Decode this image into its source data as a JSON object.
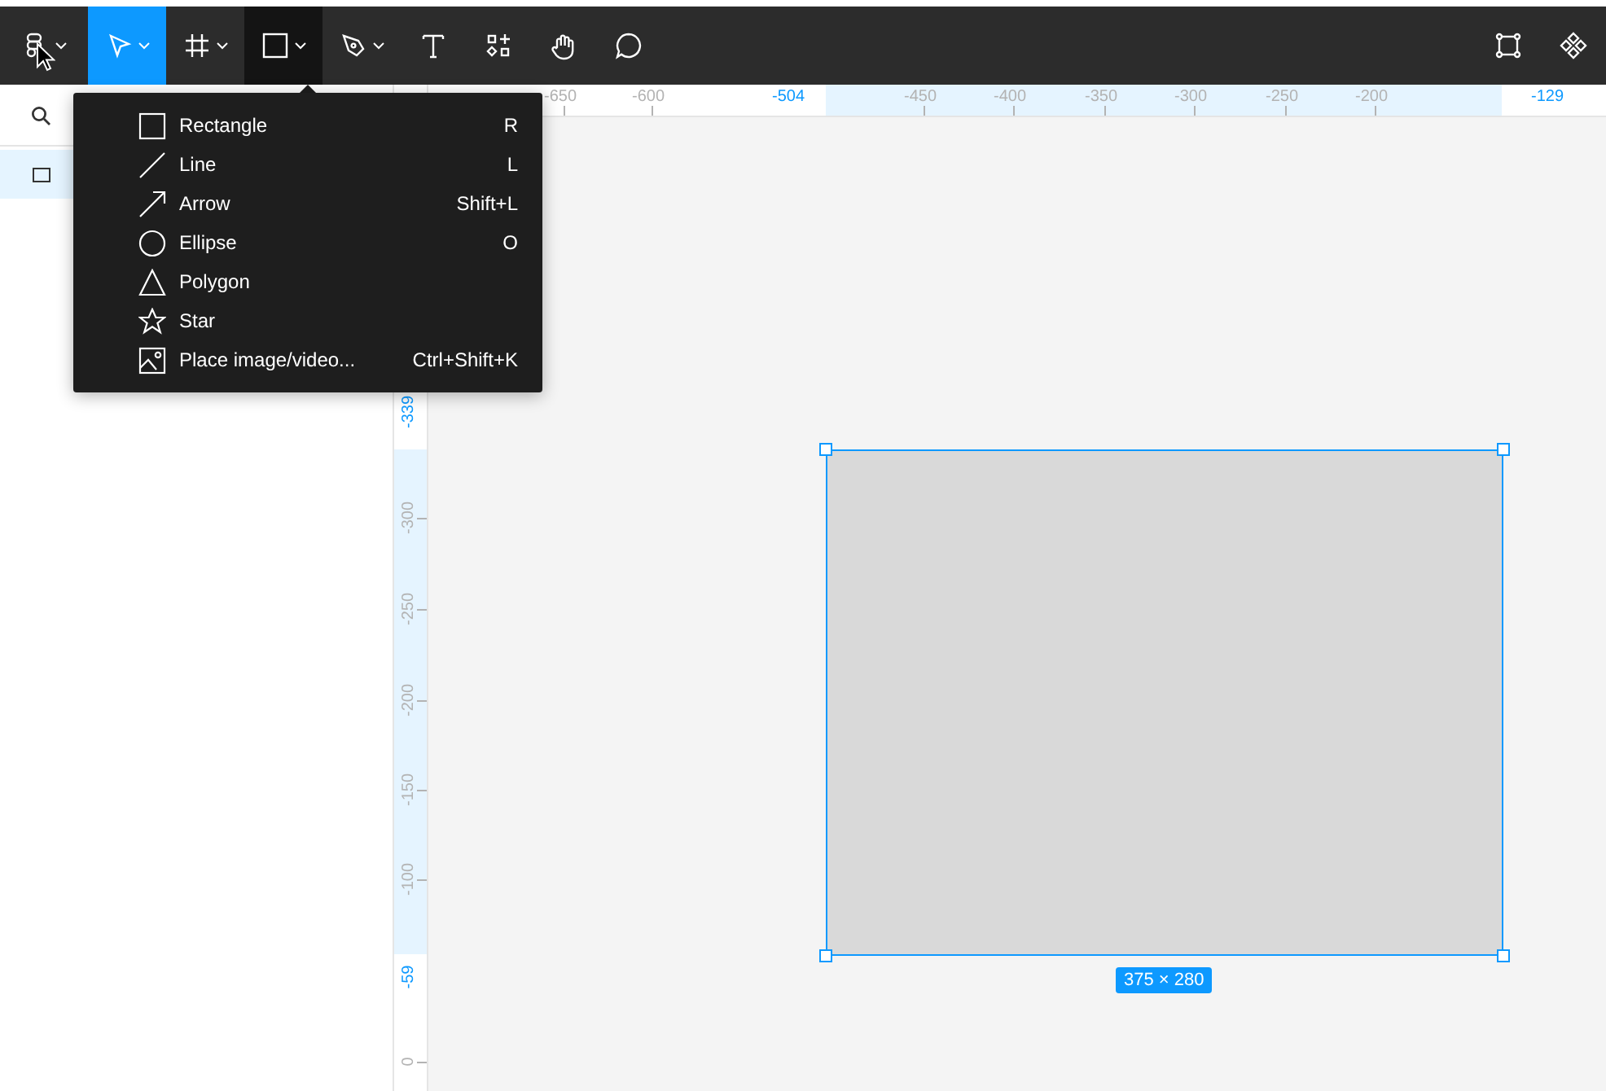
{
  "toolbar": {
    "tools": [
      {
        "kind": "main-menu",
        "selected": false,
        "open": false,
        "has_menu": true
      },
      {
        "kind": "move",
        "selected": true,
        "open": false,
        "has_menu": true
      },
      {
        "kind": "frame",
        "selected": false,
        "open": false,
        "has_menu": true
      },
      {
        "kind": "shape",
        "selected": false,
        "open": true,
        "has_menu": true
      },
      {
        "kind": "pen",
        "selected": false,
        "open": false,
        "has_menu": true
      },
      {
        "kind": "text",
        "selected": false,
        "open": false,
        "has_menu": false
      },
      {
        "kind": "resources",
        "selected": false,
        "open": false,
        "has_menu": false
      },
      {
        "kind": "hand",
        "selected": false,
        "open": false,
        "has_menu": false
      },
      {
        "kind": "comment",
        "selected": false,
        "open": false,
        "has_menu": false
      }
    ],
    "right_tools": [
      {
        "kind": "edit-object"
      },
      {
        "kind": "component"
      }
    ]
  },
  "layers_panel": {
    "layers": [
      {
        "selected": true
      }
    ]
  },
  "shape_menu": {
    "items": [
      {
        "kind": "rectangle",
        "label": "Rectangle",
        "shortcut": "R"
      },
      {
        "kind": "line",
        "label": "Line",
        "shortcut": "L"
      },
      {
        "kind": "arrow",
        "label": "Arrow",
        "shortcut": "Shift+L"
      },
      {
        "kind": "ellipse",
        "label": "Ellipse",
        "shortcut": "O"
      },
      {
        "kind": "polygon",
        "label": "Polygon"
      },
      {
        "kind": "star",
        "label": "Star"
      },
      {
        "kind": "image",
        "label": "Place image/video...",
        "shortcut": "Ctrl+Shift+K"
      }
    ]
  },
  "top_ruler": {
    "labels": [
      {
        "text": "-650",
        "kind": "tick"
      },
      {
        "text": "-600",
        "kind": "tick"
      },
      {
        "text": "-504",
        "kind": "bound"
      },
      {
        "text": "-450",
        "kind": "tick"
      },
      {
        "text": "-400",
        "kind": "tick"
      },
      {
        "text": "-350",
        "kind": "tick"
      },
      {
        "text": "-300",
        "kind": "tick"
      },
      {
        "text": "-250",
        "kind": "tick"
      },
      {
        "text": "-200",
        "kind": "tick"
      },
      {
        "text": "-129",
        "kind": "bound"
      }
    ]
  },
  "left_ruler": {
    "labels": [
      {
        "text": "-339",
        "kind": "bound"
      },
      {
        "text": "-300",
        "kind": "tick"
      },
      {
        "text": "-250",
        "kind": "tick"
      },
      {
        "text": "-200",
        "kind": "tick"
      },
      {
        "text": "-150",
        "kind": "tick"
      },
      {
        "text": "-100",
        "kind": "tick"
      },
      {
        "text": "-59",
        "kind": "bound"
      },
      {
        "text": "0",
        "kind": "tick"
      }
    ]
  },
  "canvas": {
    "shape": {
      "selected": true,
      "size_label": "375 × 280"
    }
  }
}
